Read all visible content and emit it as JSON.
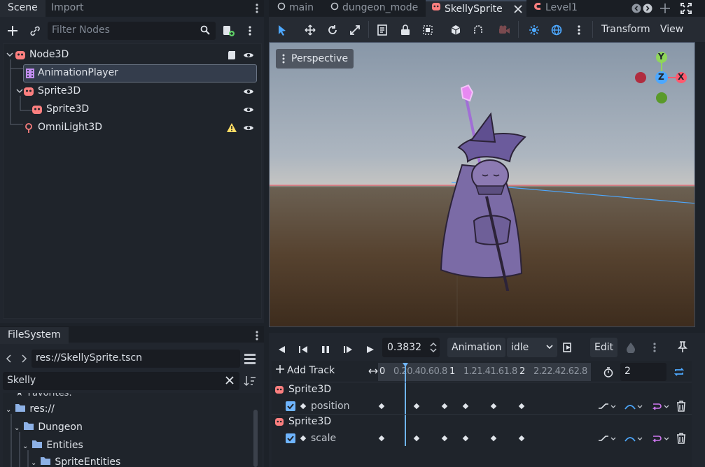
{
  "scene_dock": {
    "tabs": [
      "Scene",
      "Import"
    ],
    "filter_placeholder": "Filter Nodes",
    "nodes": [
      {
        "label": "Node3D",
        "icon": "node3d-icon"
      },
      {
        "label": "AnimationPlayer",
        "icon": "animation-player-icon"
      },
      {
        "label": "Sprite3D",
        "icon": "sprite3d-icon"
      },
      {
        "label": "Sprite3D",
        "icon": "sprite3d-icon"
      },
      {
        "label": "OmniLight3D",
        "icon": "omnilight-icon"
      }
    ]
  },
  "filesystem": {
    "tab": "FileSystem",
    "path": "res://SkellySprite.tscn",
    "search": "Skelly",
    "items": [
      "Favorites:",
      "res://",
      "Dungeon",
      "Entities",
      "SpriteEntities"
    ]
  },
  "main_tabs": [
    {
      "label": "main",
      "icon": "circle-icon"
    },
    {
      "label": "dungeon_mode",
      "icon": "circle-icon"
    },
    {
      "label": "SkellySprite",
      "icon": "node3d-icon"
    },
    {
      "label": "Level1",
      "icon": "scene-icon"
    }
  ],
  "toolbar": {
    "transform_label": "Transform",
    "view_label": "View"
  },
  "viewport": {
    "perspective_label": "Perspective",
    "gizmo": {
      "y": "Y",
      "z": "Z",
      "x": "X"
    }
  },
  "animation": {
    "time_value": "0.3832",
    "animation_label": "Animation",
    "current_animation": "idle",
    "edit_label": "Edit",
    "add_track_label": "Add Track",
    "length_value": "2",
    "ruler_labels": [
      "0",
      "0.2",
      "0.4",
      "0.6",
      "0.8",
      "1",
      "1.2",
      "1.4",
      "1.6",
      "1.8",
      "2",
      "2.2",
      "2.4",
      "2.6",
      "2.8"
    ],
    "tracks": [
      {
        "node": "Sprite3D",
        "property": "position",
        "keys": [
          0,
          0.5,
          0.9,
          1.2,
          1.6,
          2.0
        ]
      },
      {
        "node": "Sprite3D",
        "property": "scale",
        "keys": [
          0,
          0.5,
          0.9,
          1.2,
          1.6,
          2.0
        ]
      }
    ]
  },
  "colors": {
    "accent": "#4da8ff",
    "node_red": "#fc7f7f",
    "anim_purple": "#c38ef1",
    "warning": "#ffdd65"
  }
}
